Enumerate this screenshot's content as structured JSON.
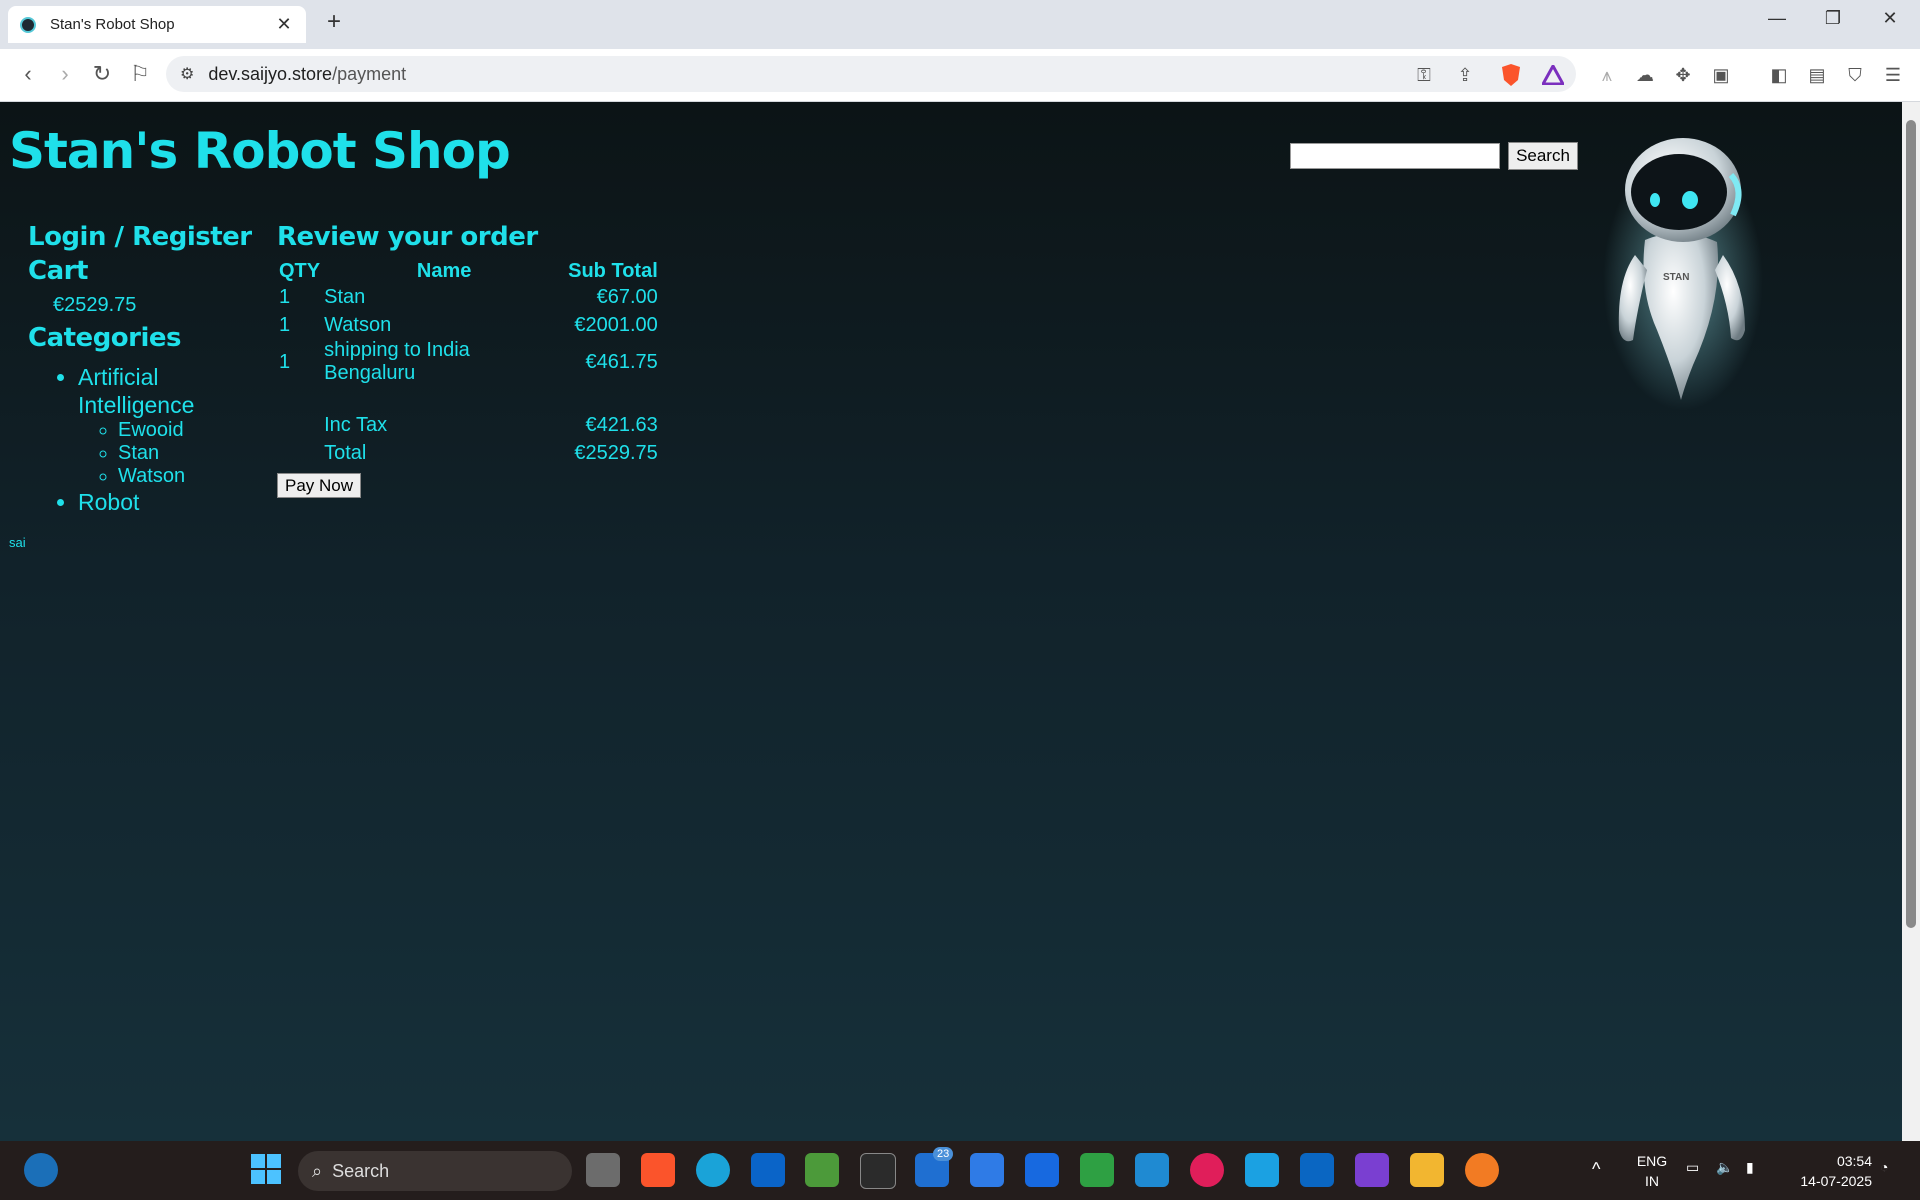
{
  "browser": {
    "tab_title": "Stan's Robot Shop",
    "new_tab_icon": "+",
    "url_host": "dev.saijyo.store",
    "url_path": "/payment"
  },
  "header": {
    "site_title": "Stan's Robot Shop",
    "search_placeholder": "",
    "search_button": "Search"
  },
  "sidebar": {
    "login_register": "Login / Register",
    "cart_label": "Cart",
    "cart_total": "€2529.75",
    "categories_label": "Categories",
    "categories": [
      {
        "label": "Artificial Intelligence",
        "products": [
          "Ewooid",
          "Stan",
          "Watson"
        ]
      },
      {
        "label": "Robot"
      }
    ]
  },
  "order": {
    "title": "Review your order",
    "columns": {
      "qty": "QTY",
      "name": "Name",
      "subtotal": "Sub Total"
    },
    "items": [
      {
        "qty": "1",
        "name": "Stan",
        "subtotal": "€67.00"
      },
      {
        "qty": "1",
        "name": "Watson",
        "subtotal": "€2001.00"
      },
      {
        "qty": "1",
        "name": "shipping to India Bengaluru",
        "subtotal": "€461.75"
      }
    ],
    "tax_label": "Inc Tax",
    "tax_value": "€421.63",
    "total_label": "Total",
    "total_value": "€2529.75",
    "pay_button": "Pay Now"
  },
  "footer": {
    "user": "sai"
  },
  "robot_badge": "STAN",
  "taskbar": {
    "search_label": "Search",
    "badge_count": "23",
    "lang_line1": "ENG",
    "lang_line2": "IN",
    "time": "03:54",
    "date": "14-07-2025"
  },
  "colors": {
    "accent": "#1fe0ea",
    "page_bg_top": "#0c1416",
    "page_bg_bottom": "#16303a"
  }
}
